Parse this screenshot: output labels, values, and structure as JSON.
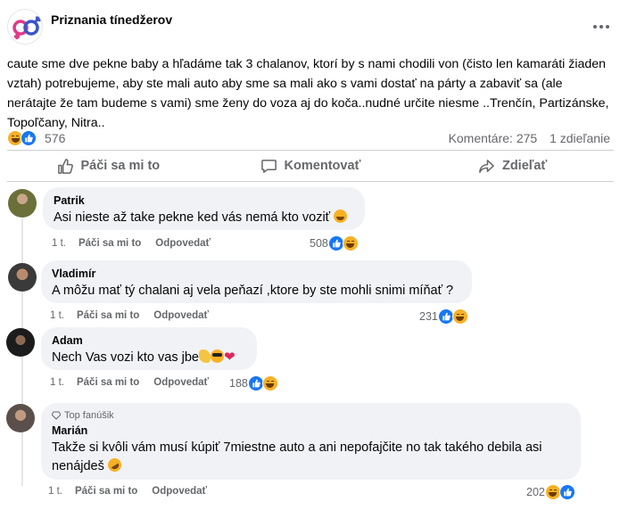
{
  "post": {
    "page_name": "Priznania tínedžerov",
    "text": "caute sme dve pekne baby a hľadáme tak 3 chalanov, ktorí by s nami chodili von (čisto len kamaráti žiaden vztah) potrebujeme, aby ste mali auto aby sme sa mali ako s vami dostať na párty a zabaviť sa (ale nerátajte že tam budeme s vami) sme ženy do voza aj do koča..nudné určite niesme ..Trenčín, Partizánske, Topoľčany, Nitra..",
    "reaction_icons": [
      "haha-icon",
      "like-icon"
    ],
    "reaction_count": "576",
    "comments_label": "Komentáre: 275",
    "shares_label": "1 zdieľanie"
  },
  "actions": {
    "like": "Páči sa mi to",
    "comment": "Komentovať",
    "share": "Zdieľať"
  },
  "comment_actions": {
    "like": "Páči sa mi to",
    "reply": "Odpovedať"
  },
  "comments": [
    {
      "author": "Patrik",
      "text": "Asi nieste až take pekne ked vás nemá kto voziť",
      "emojis": [
        "grinning-sweat-icon"
      ],
      "time": "1 t.",
      "reactions": "508",
      "reaction_icons": [
        "like-icon",
        "haha-icon"
      ]
    },
    {
      "author": "Vladimír",
      "text": "A môžu mať tý chalani aj vela peňazí ,ktore by ste mohli snimi míňať ?",
      "emojis": [],
      "time": "1 t.",
      "reactions": "231",
      "reaction_icons": [
        "like-icon",
        "haha-icon"
      ]
    },
    {
      "author": "Adam",
      "text": "Nech Vas vozi kto vas jbe",
      "emojis": [
        "ok-hand-icon",
        "sunglasses-icon",
        "heart-icon"
      ],
      "time": "1 t.",
      "reactions": "188",
      "reaction_icons": [
        "like-icon",
        "haha-icon"
      ]
    },
    {
      "badge": "Top fanúšik",
      "author": "Marián",
      "text": "Takže si kvôli vám musí kúpiť 7miestne auto a ani nepofajčite no tak takého debila asi nenájdeš",
      "emojis": [
        "rofl-icon"
      ],
      "time": "1 t.",
      "reactions": "202",
      "reaction_icons": [
        "haha-icon",
        "like-icon"
      ]
    }
  ],
  "colors": {
    "text_primary": "#050505",
    "text_secondary": "#65676b",
    "bubble_bg": "#f0f2f5",
    "like_blue": "#1877f2",
    "haha_yellow": "#f7b125",
    "divider": "#ced0d4"
  }
}
